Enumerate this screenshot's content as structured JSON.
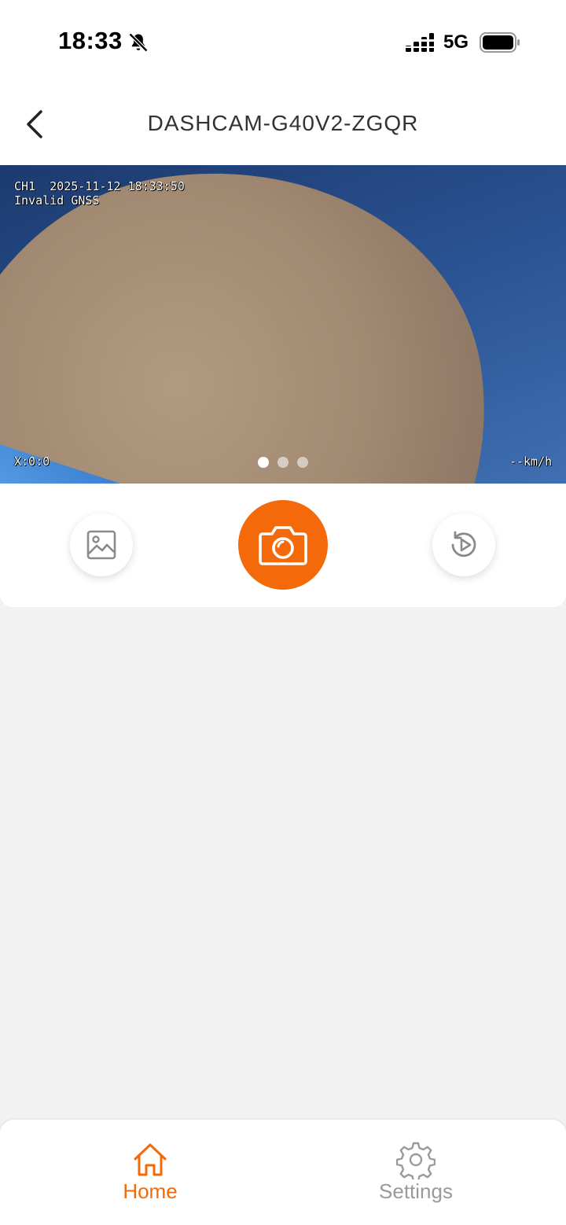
{
  "status_bar": {
    "time": "18:33",
    "network": "5G",
    "icons": [
      "bell-slash-icon",
      "signal-icon",
      "battery-icon"
    ]
  },
  "header": {
    "title": "DASHCAM-G40V2-ZGQR",
    "back_icon": "chevron-left-icon"
  },
  "video": {
    "channel": "CH1",
    "timestamp": "2025-11-12 18:33:50",
    "gnss_status": "Invalid GNSS",
    "coords": "X:0:0",
    "speed": "--km/h",
    "pages": 3,
    "active_page": 1
  },
  "controls": {
    "gallery_icon": "image-icon",
    "capture_icon": "camera-icon",
    "playback_icon": "replay-icon"
  },
  "tabs": [
    {
      "label": "Home",
      "icon": "home-icon",
      "active": true
    },
    {
      "label": "Settings",
      "icon": "gear-icon",
      "active": false
    }
  ],
  "colors": {
    "accent": "#f4690a",
    "inactive": "#9a9a9a",
    "background": "#f2f2f2"
  }
}
